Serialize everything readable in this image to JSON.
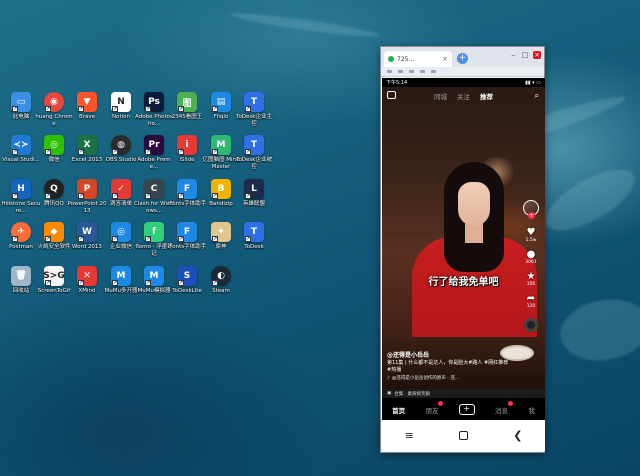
{
  "wallpaper": {
    "colors": [
      "#1f6f8a",
      "#0b4464"
    ]
  },
  "desktop_icons": [
    {
      "label": "此电脑",
      "icon": "computer-icon",
      "color": "#3a8ee6",
      "glyph": "▭"
    },
    {
      "label": "huang Chrome",
      "icon": "chrome-icon",
      "color": "#e8453c",
      "glyph": "◉",
      "round": true
    },
    {
      "label": "Brave",
      "icon": "brave-icon",
      "color": "#fb542b",
      "glyph": "▼"
    },
    {
      "label": "Notion",
      "icon": "notion-icon",
      "color": "#ffffff",
      "glyph": "N",
      "dark": true
    },
    {
      "label": "Adobe Photosho...",
      "icon": "photoshop-icon",
      "color": "#0b1c3a",
      "glyph": "Ps"
    },
    {
      "label": "2345看图王",
      "icon": "2345-viewer-icon",
      "color": "#4caf50",
      "glyph": "图"
    },
    {
      "label": "Fliqlo",
      "icon": "fliqlo-icon",
      "color": "#1e88e5",
      "glyph": "▤"
    },
    {
      "label": "ToDesk企业主控",
      "icon": "todesk-icon",
      "color": "#2f6fe8",
      "glyph": "T"
    },
    {
      "label": "Visual Studi...",
      "icon": "vscode-icon",
      "color": "#1f7ad6",
      "glyph": "≺≻"
    },
    {
      "label": "微信",
      "icon": "wechat-icon",
      "color": "#2dc100",
      "glyph": "◎"
    },
    {
      "label": "Excel 2013",
      "icon": "excel-icon",
      "color": "#1e7145",
      "glyph": "X"
    },
    {
      "label": "OBS Studio",
      "icon": "obs-icon",
      "color": "#2b2b2b",
      "glyph": "◍",
      "round": true
    },
    {
      "label": "Adobe Preme...",
      "icon": "premiere-icon",
      "color": "#2a0a3b",
      "glyph": "Pr"
    },
    {
      "label": "iSlide",
      "icon": "islide-icon",
      "color": "#e53935",
      "glyph": "i"
    },
    {
      "label": "亿图脑图 MindMaster",
      "icon": "mindmaster-icon",
      "color": "#2eb872",
      "glyph": "M"
    },
    {
      "label": "ToDesk企业被控",
      "icon": "todesk-controlled-icon",
      "color": "#2f6fe8",
      "glyph": "T"
    },
    {
      "label": "Hillstone Secure...",
      "icon": "hillstone-icon",
      "color": "#1565c0",
      "glyph": "H"
    },
    {
      "label": "腾讯QQ",
      "icon": "qq-icon",
      "color": "#222222",
      "glyph": "Q",
      "round": true
    },
    {
      "label": "PowerPoint 2013",
      "icon": "powerpoint-icon",
      "color": "#d24726",
      "glyph": "P"
    },
    {
      "label": "滴答清单",
      "icon": "ticktick-icon",
      "color": "#e53935",
      "glyph": "✓"
    },
    {
      "label": "Clash for Windows...",
      "icon": "clash-icon",
      "color": "#37474f",
      "glyph": "C"
    },
    {
      "label": "iFonts字体助手",
      "icon": "ifonts-icon",
      "color": "#1e88e5",
      "glyph": "F"
    },
    {
      "label": "Bandizip",
      "icon": "bandizip-icon",
      "color": "#f0b400",
      "glyph": "B"
    },
    {
      "label": "英雄联盟",
      "icon": "lol-icon",
      "color": "#1c2c4c",
      "glyph": "L"
    },
    {
      "label": "Postman",
      "icon": "postman-icon",
      "color": "#ff6c37",
      "glyph": "✈",
      "round": true
    },
    {
      "label": "火绒安全软件",
      "icon": "huorong-icon",
      "color": "#ff8a00",
      "glyph": "◆"
    },
    {
      "label": "Word 2013",
      "icon": "word-icon",
      "color": "#2b579a",
      "glyph": "W"
    },
    {
      "label": "企业微信",
      "icon": "wecom-icon",
      "color": "#1e88e5",
      "glyph": "◎"
    },
    {
      "label": "flomo · 浮墨笔记",
      "icon": "flomo-icon",
      "color": "#30cf79",
      "glyph": "f"
    },
    {
      "label": "iFonts字体助手",
      "icon": "ifonts-icon-2",
      "color": "#1e88e5",
      "glyph": "F"
    },
    {
      "label": "原神",
      "icon": "genshin-icon",
      "color": "#e0c68c",
      "glyph": "✦"
    },
    {
      "label": "ToDesk",
      "icon": "todesk-app-icon",
      "color": "#2f6fe8",
      "glyph": "T"
    },
    {
      "label": "回收站",
      "icon": "recycle-bin-icon",
      "color": "#9fb6c8",
      "glyph": "🗑"
    },
    {
      "label": "ScreenToGif",
      "icon": "screentogif-icon",
      "color": "#f5f5f5",
      "glyph": "S>G",
      "dark": true
    },
    {
      "label": "XMind",
      "icon": "xmind-icon",
      "color": "#e53935",
      "glyph": "✕"
    },
    {
      "label": "MuMu多开器",
      "icon": "mumu-multi-icon",
      "color": "#1e88e5",
      "glyph": "M"
    },
    {
      "label": "MuMu模拟器",
      "icon": "mumu-emulator-icon",
      "color": "#1e88e5",
      "glyph": "M"
    },
    {
      "label": "ToDeskLite",
      "icon": "todesklite-icon",
      "color": "#1e4fb8",
      "glyph": "S"
    },
    {
      "label": "Steam",
      "icon": "steam-icon",
      "color": "#1b2838",
      "glyph": "◐",
      "round": true
    }
  ],
  "mirror_window": {
    "tab_title": "725...",
    "tab_close": "×",
    "add_tab": "+",
    "controls": {
      "minimize": "–",
      "maximize": "□",
      "close": "×"
    }
  },
  "phone": {
    "status_time": "下午5:14",
    "status_right": "▮▮ ▾ ▭",
    "top_nav": [
      {
        "label": "同城",
        "active": false
      },
      {
        "label": "关注",
        "active": false
      },
      {
        "label": "推荐",
        "active": true
      }
    ],
    "search_icon": "⌕",
    "caption": "行了给我免单吧",
    "side": {
      "like_count": "1.5w",
      "comment_count": "3061",
      "favorite_count": "356",
      "share_count": "120"
    },
    "author": "@还得是小岳岳",
    "description": "第11集 | 什么都不是达人，你是脸大#路人 #网红推荐 #热播",
    "music": "@还得是小岳岳创作的原声 - 还...",
    "collection": "合集 · 素质搞笑剧",
    "tabs": [
      {
        "label": "首页",
        "active": true
      },
      {
        "label": "朋友",
        "active": false,
        "badge": true
      },
      {
        "label": "+",
        "plus": true
      },
      {
        "label": "消息",
        "active": false,
        "badge": true
      },
      {
        "label": "我",
        "active": false
      }
    ],
    "sub_nav": [
      "⋮",
      "◀",
      "○",
      "↓"
    ],
    "nav_buttons": {
      "menu": "≡",
      "home": "",
      "back": "❮"
    }
  }
}
